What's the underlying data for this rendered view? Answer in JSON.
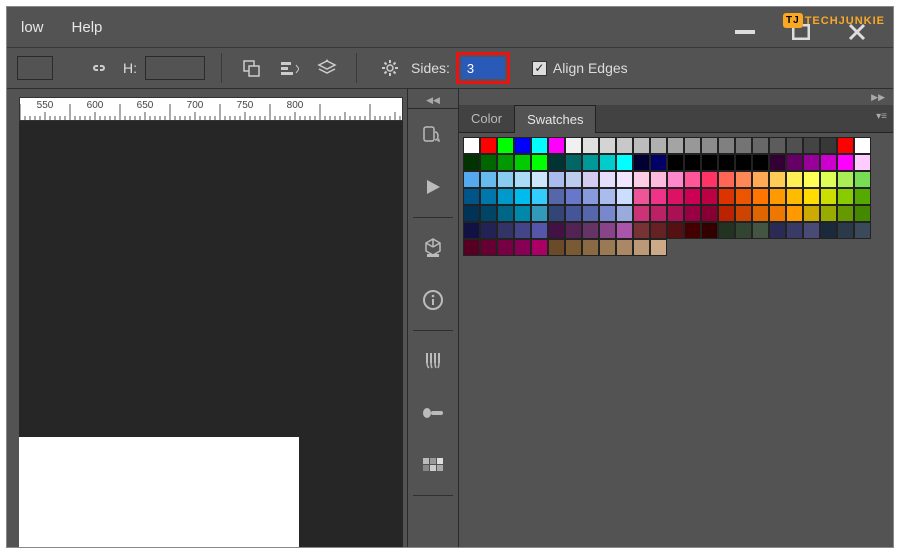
{
  "watermark": {
    "badge": "TJ",
    "text": "TECHJUNKIE"
  },
  "menu": {
    "low": "low",
    "help": "Help"
  },
  "options": {
    "h_label": "H:",
    "sides_label": "Sides:",
    "sides_value": "3",
    "align_edges": "Align Edges",
    "align_checked": true
  },
  "ruler": {
    "marks": [
      "550",
      "600",
      "650",
      "700",
      "750",
      "800"
    ]
  },
  "panel": {
    "tab_color": "Color",
    "tab_swatches": "Swatches"
  },
  "icons": {
    "link": "link-icon",
    "anti": "anti-alias-icon",
    "align": "align-icon",
    "stack": "stack-arrange-icon",
    "gear": "gear-icon",
    "min": "minimize-icon",
    "max": "maximize-icon",
    "close": "close-icon",
    "history": "history-icon",
    "play": "actions-play-icon",
    "cube": "render-3d-icon",
    "info": "info-icon",
    "brushes": "brushes-icon",
    "brush": "brush-preset-icon",
    "samples": "color-samples-icon",
    "collapse": "collapse-arrows-icon",
    "expand": "expand-arrows-icon",
    "panelmenu": "panel-menu-icon",
    "check": "check-icon"
  },
  "swatches": [
    [
      "#ffffff",
      "#ff0000",
      "#00ff00",
      "#0000ff",
      "#00ffff",
      "#ff00ff",
      "#f0f0f0",
      "#e0e0e0",
      "#d4d4d4",
      "#c8c8c8",
      "#bcbcbc",
      "#b0b0b0",
      "#a4a4a4",
      "#989898",
      "#8c8c8c",
      "#808080",
      "#747474",
      "#686868",
      "#5c5c5c",
      "#505050",
      "#444444",
      "#383838",
      "#ff0000",
      "#ffffff"
    ],
    [
      "#003300",
      "#006600",
      "#009900",
      "#00cc00",
      "#00ff00",
      "#003333",
      "#006666",
      "#009999",
      "#00cccc",
      "#00ffff",
      "#000033",
      "#000066",
      "#000000",
      "#000000",
      "#000000",
      "#000000",
      "#000000",
      "#000000",
      "#330033",
      "#660066",
      "#990099",
      "#cc00cc",
      "#ff00ff",
      "#ffccff"
    ],
    [
      "#55aaee",
      "#66bbee",
      "#88ccf0",
      "#aaddf5",
      "#cce6fa",
      "#aabbee",
      "#bbccee",
      "#d4ccf0",
      "#e6ddfa",
      "#f0e6ff",
      "#ffcce6",
      "#ffbbdd",
      "#ff88cc",
      "#ff5599",
      "#ff3366",
      "#ff6655",
      "#ff8855",
      "#ffaa55",
      "#ffcc55",
      "#ffee55",
      "#ffff55",
      "#ddff55",
      "#aaee55",
      "#77dd55"
    ],
    [
      "#005588",
      "#0077aa",
      "#0099cc",
      "#00bbee",
      "#33ccff",
      "#5566aa",
      "#6677cc",
      "#8899dd",
      "#aabbee",
      "#ccddff",
      "#ee5599",
      "#ee3388",
      "#dd1166",
      "#cc0055",
      "#bb0044",
      "#dd3300",
      "#ee5500",
      "#ff7700",
      "#ff9900",
      "#ffbb00",
      "#ffdd00",
      "#ccdd00",
      "#88cc00",
      "#55aa00"
    ],
    [
      "#003355",
      "#004466",
      "#006688",
      "#0088aa",
      "#3399bb",
      "#334477",
      "#445599",
      "#5566aa",
      "#7788cc",
      "#99aadd",
      "#cc3377",
      "#bb2266",
      "#aa1155",
      "#990044",
      "#880033",
      "#bb2200",
      "#cc4400",
      "#dd6600",
      "#ee7700",
      "#ff9900",
      "#ccaa00",
      "#99aa00",
      "#669900",
      "#448800"
    ],
    [
      "#111144",
      "#222255",
      "#333366",
      "#444488",
      "#5555aa",
      "#441144",
      "#552255",
      "#663366",
      "#884488",
      "#aa55aa",
      "#773333",
      "#662222",
      "#551111",
      "#440000",
      "#330000",
      "#223322",
      "#334433",
      "#445544",
      "#2a2a55",
      "#3a3a66",
      "#4a4a77",
      "#1a2a3a",
      "#2a3a4a",
      "#3a4a5a"
    ],
    [
      "#550022",
      "#660033",
      "#770044",
      "#880055",
      "#aa0066",
      "#6b4a2a",
      "#7a5a33",
      "#8a6a44",
      "#9a7a55",
      "#aa8866",
      "#bb9977",
      "#ccaa88"
    ]
  ]
}
